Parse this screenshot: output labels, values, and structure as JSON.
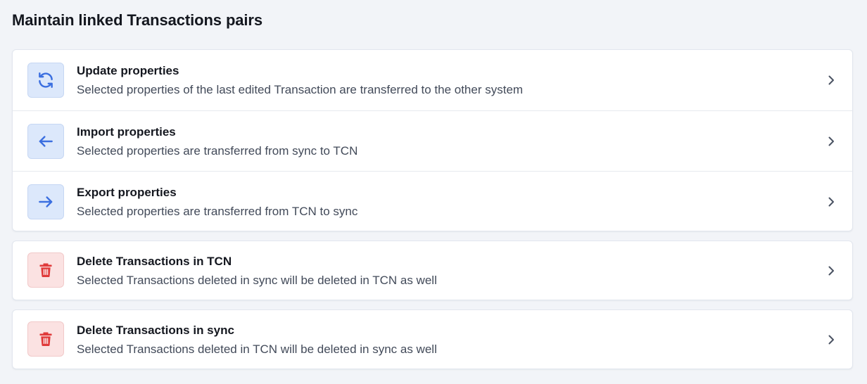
{
  "page": {
    "title": "Maintain linked Transactions pairs"
  },
  "sync_group": [
    {
      "icon": "refresh-icon",
      "title": "Update properties",
      "description": "Selected properties of the last edited Transaction are transferred to the other system"
    },
    {
      "icon": "arrow-left-icon",
      "title": "Import properties",
      "description": "Selected properties are transferred from sync to TCN"
    },
    {
      "icon": "arrow-right-icon",
      "title": "Export properties",
      "description": "Selected properties are transferred from TCN to sync"
    }
  ],
  "delete_tcn": {
    "icon": "trash-icon",
    "title": "Delete Transactions in TCN",
    "description": "Selected Transactions deleted in sync will be deleted in TCN as well"
  },
  "delete_sync": {
    "icon": "trash-icon",
    "title": "Delete Transactions in sync",
    "description": "Selected Transactions deleted in TCN will be deleted in sync as well"
  },
  "colors": {
    "accent_blue": "#3b6fe0",
    "danger_red": "#e03a3a",
    "background": "#f2f4f8"
  }
}
